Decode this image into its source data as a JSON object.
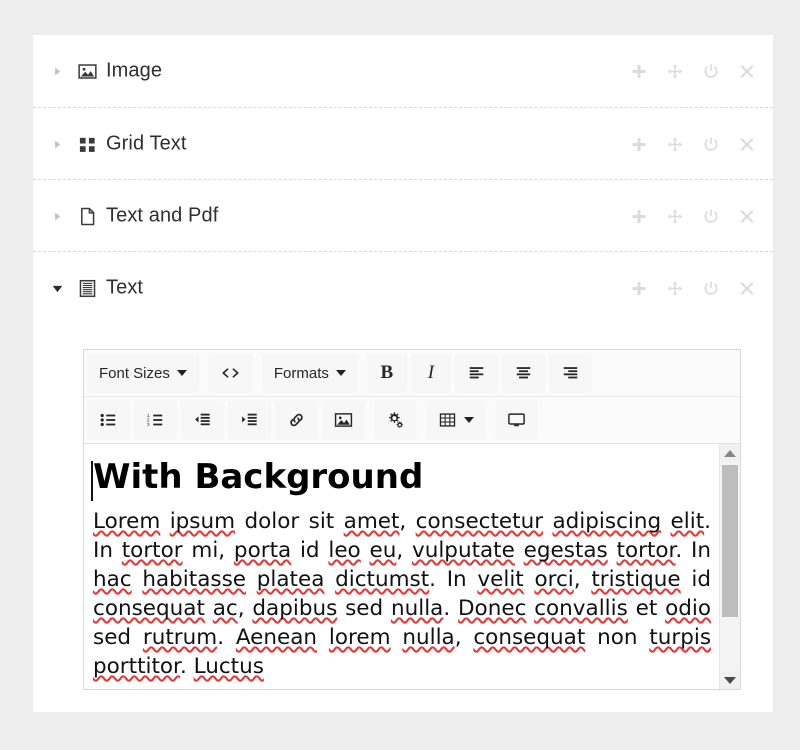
{
  "theme": {
    "page_background": "#ededed",
    "card_background": "#ffffff",
    "divider_color": "#d9d9d9",
    "action_icon_color": "#dcdcdc",
    "label_color": "#2f2f2f",
    "spellcheck_underline_color": "#e03a3a",
    "scrollbar_thumb": "#bdbdbd"
  },
  "row_actions": [
    {
      "name": "add-icon",
      "label": "Add"
    },
    {
      "name": "move-icon",
      "label": "Move"
    },
    {
      "name": "power-toggle-icon",
      "label": "Enable/Disable"
    },
    {
      "name": "close-icon",
      "label": "Remove"
    }
  ],
  "modules": [
    {
      "label": "Image",
      "icon": "image-icon",
      "expanded": false,
      "caret": "collapsed"
    },
    {
      "label": "Grid Text",
      "icon": "grid-icon",
      "expanded": false,
      "caret": "collapsed"
    },
    {
      "label": "Text and Pdf",
      "icon": "file-icon",
      "expanded": false,
      "caret": "collapsed"
    },
    {
      "label": "Text",
      "icon": "text-lines-icon",
      "expanded": true,
      "caret": "expanded"
    }
  ],
  "editor": {
    "toolbar_row_1": [
      {
        "name": "font-sizes-dropdown",
        "label": "Font Sizes",
        "icon": "",
        "dropdown": true
      },
      {
        "name": "source-code-button",
        "label": "",
        "icon": "code-icon",
        "dropdown": false
      },
      {
        "name": "formats-dropdown",
        "label": "Formats",
        "icon": "",
        "dropdown": true
      },
      {
        "name": "bold-button",
        "label": "B",
        "icon": "bold-icon",
        "dropdown": false
      },
      {
        "name": "italic-button",
        "label": "I",
        "icon": "italic-icon",
        "dropdown": false
      },
      {
        "name": "align-left-button",
        "label": "",
        "icon": "align-left-icon",
        "dropdown": false
      },
      {
        "name": "align-center-button",
        "label": "",
        "icon": "align-center-icon",
        "dropdown": false
      },
      {
        "name": "align-right-button",
        "label": "",
        "icon": "align-right-icon",
        "dropdown": false
      }
    ],
    "toolbar_row_2": [
      {
        "name": "bullet-list-button",
        "label": "",
        "icon": "bullet-list-icon",
        "dropdown": false
      },
      {
        "name": "numbered-list-button",
        "label": "",
        "icon": "numbered-list-icon",
        "dropdown": false
      },
      {
        "name": "outdent-button",
        "label": "",
        "icon": "outdent-icon",
        "dropdown": false
      },
      {
        "name": "indent-button",
        "label": "",
        "icon": "indent-icon",
        "dropdown": false
      },
      {
        "name": "insert-link-button",
        "label": "",
        "icon": "link-icon",
        "dropdown": false
      },
      {
        "name": "insert-image-button",
        "label": "",
        "icon": "image-icon",
        "dropdown": false
      },
      {
        "name": "settings-button",
        "label": "",
        "icon": "gears-icon",
        "dropdown": false
      },
      {
        "name": "table-dropdown",
        "label": "",
        "icon": "table-icon",
        "dropdown": true
      },
      {
        "name": "preview-button",
        "label": "",
        "icon": "monitor-icon",
        "dropdown": false
      }
    ],
    "document": {
      "heading": "With Background",
      "paragraph_runs": [
        {
          "t": "Lorem",
          "sp": true
        },
        {
          "t": " ",
          "sp": false
        },
        {
          "t": "ipsum",
          "sp": true
        },
        {
          "t": " dolor sit ",
          "sp": false
        },
        {
          "t": "amet",
          "sp": true
        },
        {
          "t": ", ",
          "sp": false
        },
        {
          "t": "consectetur",
          "sp": true
        },
        {
          "t": " ",
          "sp": false
        },
        {
          "t": "adipiscing",
          "sp": true
        },
        {
          "t": " ",
          "sp": false
        },
        {
          "t": "elit",
          "sp": true
        },
        {
          "t": ". In ",
          "sp": false
        },
        {
          "t": "tortor",
          "sp": true
        },
        {
          "t": " mi, ",
          "sp": false
        },
        {
          "t": "porta",
          "sp": true
        },
        {
          "t": " id ",
          "sp": false
        },
        {
          "t": "leo",
          "sp": true
        },
        {
          "t": " ",
          "sp": false
        },
        {
          "t": "eu",
          "sp": true
        },
        {
          "t": ", ",
          "sp": false
        },
        {
          "t": "vulputate",
          "sp": true
        },
        {
          "t": " ",
          "sp": false
        },
        {
          "t": "egestas",
          "sp": true
        },
        {
          "t": " ",
          "sp": false
        },
        {
          "t": "tortor",
          "sp": true
        },
        {
          "t": ". In ",
          "sp": false
        },
        {
          "t": "hac",
          "sp": true
        },
        {
          "t": " ",
          "sp": false
        },
        {
          "t": "habitasse",
          "sp": true
        },
        {
          "t": " ",
          "sp": false
        },
        {
          "t": "platea",
          "sp": true
        },
        {
          "t": " ",
          "sp": false
        },
        {
          "t": "dictumst",
          "sp": true
        },
        {
          "t": ". In ",
          "sp": false
        },
        {
          "t": "velit",
          "sp": true
        },
        {
          "t": " ",
          "sp": false
        },
        {
          "t": "orci",
          "sp": true
        },
        {
          "t": ", ",
          "sp": false
        },
        {
          "t": "tristique",
          "sp": true
        },
        {
          "t": " id ",
          "sp": false
        },
        {
          "t": "consequat",
          "sp": true
        },
        {
          "t": " ",
          "sp": false
        },
        {
          "t": "ac",
          "sp": true
        },
        {
          "t": ", ",
          "sp": false
        },
        {
          "t": "dapibus",
          "sp": true
        },
        {
          "t": " sed ",
          "sp": false
        },
        {
          "t": "nulla",
          "sp": true
        },
        {
          "t": ". ",
          "sp": false
        },
        {
          "t": "Donec",
          "sp": true
        },
        {
          "t": " ",
          "sp": false
        },
        {
          "t": "convallis",
          "sp": true
        },
        {
          "t": " et ",
          "sp": false
        },
        {
          "t": "odio",
          "sp": true
        },
        {
          "t": " sed ",
          "sp": false
        },
        {
          "t": "rutrum",
          "sp": true
        },
        {
          "t": ". ",
          "sp": false
        },
        {
          "t": "Aenean",
          "sp": true
        },
        {
          "t": " ",
          "sp": false
        },
        {
          "t": "lorem",
          "sp": true
        },
        {
          "t": " ",
          "sp": false
        },
        {
          "t": "nulla",
          "sp": true
        },
        {
          "t": ", ",
          "sp": false
        },
        {
          "t": "consequat",
          "sp": true
        },
        {
          "t": " non ",
          "sp": false
        },
        {
          "t": "turpis",
          "sp": true
        },
        {
          "t": " ",
          "sp": false
        },
        {
          "t": "porttitor",
          "sp": true
        },
        {
          "t": ". ",
          "sp": false
        },
        {
          "t": "Luctus",
          "sp": true
        }
      ],
      "paragraph_plain": "Lorem ipsum dolor sit amet, consectetur adipiscing elit. In tortor mi, porta id leo eu, vulputate egestas tortor. In hac habitasse platea dictumst. In velit orci, tristique id consequat ac, dapibus sed nulla. Donec convallis et odio sed rutrum. Aenean lorem nulla, consequat non turpis porttitor. Luctus"
    },
    "scrollbar": {
      "up_arrow": "scroll-up-arrow",
      "down_arrow": "scroll-down-arrow",
      "thumb_position_percent": 8
    }
  }
}
